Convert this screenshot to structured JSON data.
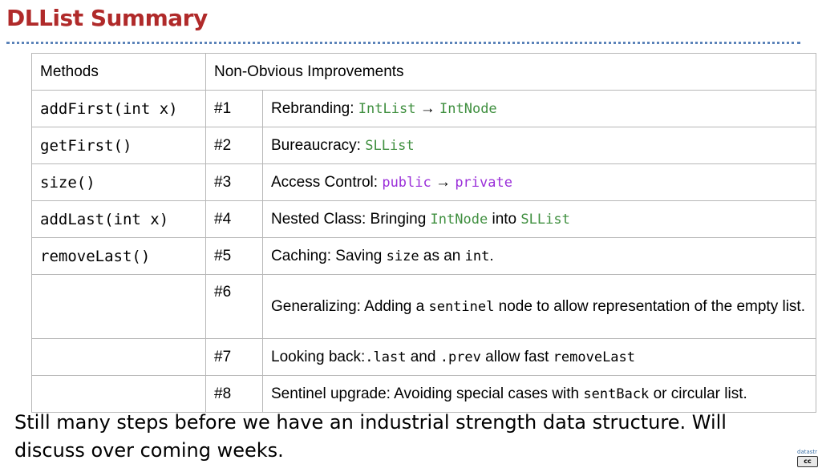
{
  "slide": {
    "title": "DLList Summary",
    "title_color": "#b02a2a",
    "code_green": "#3f8f3f",
    "code_purple": "#9b30d9",
    "footnote": "Still many steps before we have an industrial strength data structure. Will discuss over coming weeks.",
    "cc_label": "datastr",
    "cc_badge": "cc"
  },
  "table": {
    "header": {
      "methods": "Methods",
      "improvements": "Non-Obvious Improvements"
    },
    "methods": [
      "addFirst(int x)",
      "getFirst()",
      "size()",
      "addLast(int x)",
      "removeLast()"
    ],
    "improvements": [
      {
        "num": "#1",
        "parts": [
          {
            "t": "Rebranding: "
          },
          {
            "t": "IntList",
            "c": "green"
          },
          {
            "t": " → "
          },
          {
            "t": "IntNode",
            "c": "green"
          }
        ]
      },
      {
        "num": "#2",
        "parts": [
          {
            "t": "Bureaucracy: "
          },
          {
            "t": "SLList",
            "c": "green"
          }
        ]
      },
      {
        "num": "#3",
        "parts": [
          {
            "t": "Access Control: "
          },
          {
            "t": "public",
            "c": "purple"
          },
          {
            "t": " → "
          },
          {
            "t": "private",
            "c": "purple"
          }
        ]
      },
      {
        "num": "#4",
        "parts": [
          {
            "t": "Nested Class: Bringing "
          },
          {
            "t": "IntNode",
            "c": "green"
          },
          {
            "t": " into "
          },
          {
            "t": "SLList",
            "c": "green"
          }
        ]
      },
      {
        "num": "#5",
        "parts": [
          {
            "t": "Caching: Saving "
          },
          {
            "t": "size",
            "c": "mono"
          },
          {
            "t": " as an "
          },
          {
            "t": "int",
            "c": "mono"
          },
          {
            "t": "."
          }
        ]
      },
      {
        "num": "#6",
        "parts": [
          {
            "t": "Generalizing: Adding a "
          },
          {
            "t": "sentinel",
            "c": "mono"
          },
          {
            "t": " node to allow representation of the empty list."
          }
        ]
      },
      {
        "num": "#7",
        "parts": [
          {
            "t": "Looking back:"
          },
          {
            "t": ".last",
            "c": "mono"
          },
          {
            "t": " and "
          },
          {
            "t": ".prev",
            "c": "mono"
          },
          {
            "t": " allow fast "
          },
          {
            "t": "removeLast",
            "c": "mono"
          }
        ]
      },
      {
        "num": "#8",
        "parts": [
          {
            "t": "Sentinel upgrade: Avoiding special cases with "
          },
          {
            "t": "sentBack",
            "c": "mono"
          },
          {
            "t": " or circular list."
          }
        ]
      }
    ]
  }
}
